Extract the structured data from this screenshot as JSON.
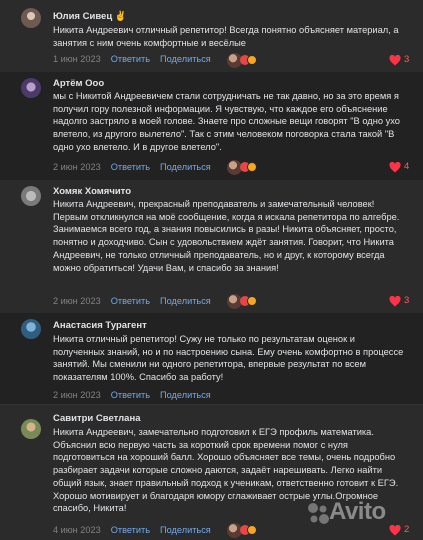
{
  "actions": {
    "reply": "Ответить",
    "share": "Поделиться"
  },
  "comments": [
    {
      "author": "Юлия Сивец ✌",
      "text": "Никита Андреевич отличный репетитор! Всегда понятно объясняет материал, а занятия с ним очень комфортные и весёлые",
      "date": "1 июн 2023",
      "likes": "3"
    },
    {
      "author": "Артём Ооо",
      "text": "мы с Никитой Андреевичем стали сотрудничать не так давно, но за это время я получил гору полезной информации. Я чувствую, что каждое его объяснение надолго застряло в моей голове. Знаете про сложные вещи говорят \"В одно ухо влетело, из другого вылетело\". Так с этим человеком поговорка стала такой \"В одно ухо влетело. И в другое влетело\".",
      "date": "2 июн 2023",
      "likes": "4"
    },
    {
      "author": "Хомяк Хомячито",
      "text": "Никита Андреевич, прекрасный преподаватель и замечательный человек! Первым откликнулся на моё сообщение, когда я искала репетитора по алгебре. Занимаемся всего год, а знания повысились в разы! Никита объясняет, просто, понятно и доходчиво. Сын с удовольствием ждёт занятия. Говорит, что Никита Андреевич, не только отличный преподаватель, но и друг, к которому всегда можно обратиться! Удачи Вам, и спасибо за знания!",
      "date": "2 июн 2023",
      "likes": "3"
    },
    {
      "author": "Анастасия Турагент",
      "text": "Никита отличный репетитор! Сужу не только по результатам оценок и полученных знаний, но и по настроению сына. Ему очень комфортно в процессе занятий. Мы сменили ни одного репетитора, впервые результат по всем показателям 100%. Спасибо за работу!",
      "date": "2 июн 2023",
      "likes": "3"
    },
    {
      "author": "Савитри Светлана",
      "text": "Никита Андреевич, замечательно подготовил к ЕГЭ профиль математика. Объяснил всю первую часть за короткий срок времени помог с нуля подготовиться на хороший балл. Хорошо объясняет все темы, очень подробно разбирает задачи которые сложно даются, задаёт нарешивать. Легко найти общий язык, знает правильный подход к ученикам, ответственно готовит к ЕГЭ. Хорошо мотивирует и благодаря юмору сглаживает острые углы.Огромное спасибо, Никита!",
      "date": "4 июн 2023",
      "likes": "2"
    }
  ],
  "watermark": "Avito"
}
